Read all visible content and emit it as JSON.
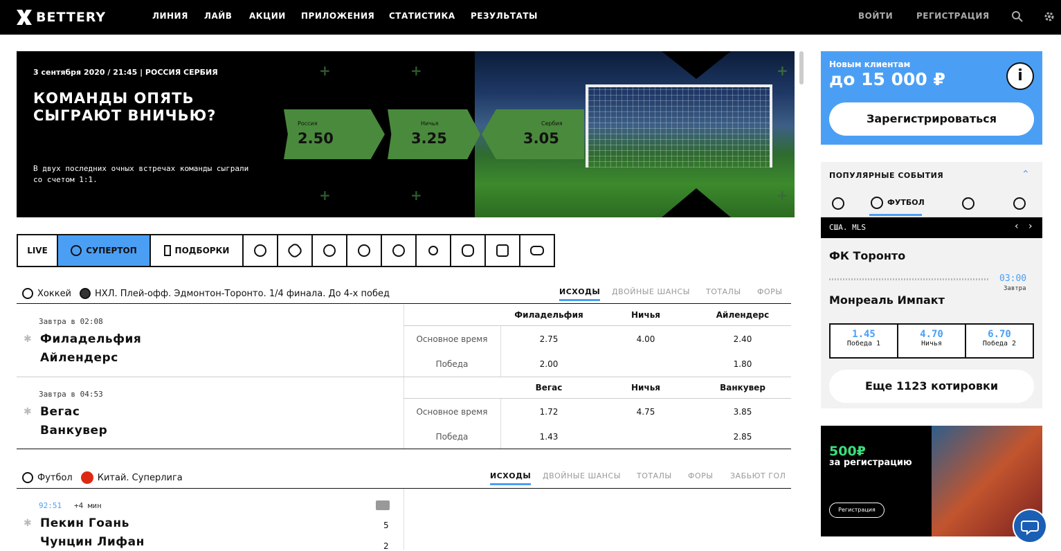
{
  "header": {
    "logo": "BETTERY",
    "nav": [
      "ЛИНИЯ",
      "ЛАЙВ",
      "АКЦИИ",
      "ПРИЛОЖЕНИЯ",
      "СТАТИСТИКА",
      "РЕЗУЛЬТАТЫ"
    ],
    "login": "ВОЙТИ",
    "register": "РЕГИСТРАЦИЯ"
  },
  "banner": {
    "date": "3 сентября 2020 / 21:45 | РОССИЯ СЕРБИЯ",
    "headline": "КОМАНДЫ ОПЯТЬ СЫГРАЮТ ВНИЧЬЮ?",
    "description": "В двух последних очных встречах команды сыграли со счетом 1:1.",
    "odds": [
      {
        "name": "Россия",
        "value": "2.50"
      },
      {
        "name": "Ничья",
        "value": "3.25"
      },
      {
        "name": "Сербия",
        "value": "3.05"
      }
    ]
  },
  "sport_tabs": {
    "live": "LIVE",
    "supertop": "СУПЕРТОП",
    "collections": "ПОДБОРКИ"
  },
  "hockey": {
    "sport": "Хоккей",
    "league": "НХЛ. Плей-офф. Эдмонтон-Торонто. 1/4 финала. До 4-х побед",
    "tabs": [
      "ИСХОДЫ",
      "ДВОЙНЫЕ ШАНСЫ",
      "ТОТАЛЫ",
      "ФОРЫ"
    ],
    "matches": [
      {
        "when": "Завтра в 02:08",
        "team1": "Филадельфия",
        "team2": "Айлендерс",
        "cols": [
          "Филадельфия",
          "Ничья",
          "Айлендерс"
        ],
        "row1_label": "Основное время",
        "row1": [
          "2.75",
          "4.00",
          "2.40"
        ],
        "row2_label": "Победа",
        "row2": [
          "2.00",
          "",
          "1.80"
        ]
      },
      {
        "when": "Завтра в 04:53",
        "team1": "Вегас",
        "team2": "Ванкувер",
        "cols": [
          "Вегас",
          "Ничья",
          "Ванкувер"
        ],
        "row1_label": "Основное время",
        "row1": [
          "1.72",
          "4.75",
          "3.85"
        ],
        "row2_label": "Победа",
        "row2": [
          "1.43",
          "",
          "2.85"
        ]
      }
    ]
  },
  "football": {
    "sport": "Футбол",
    "league": "Китай. Суперлига",
    "tabs": [
      "ИСХОДЫ",
      "ДВОЙНЫЕ ШАНСЫ",
      "ТОТАЛЫ",
      "ФОРЫ",
      "ЗАБЬЮТ ГОЛ"
    ],
    "match": {
      "minute": "92:51",
      "added": "+4 мин",
      "team1": "Пекин Гоань",
      "score1": "5",
      "team2": "Чунцин Лифан",
      "score2": "2"
    }
  },
  "promo": {
    "line1": "Новым клиентам",
    "line2": "до 15 000 ₽",
    "button": "Зарегистрироваться"
  },
  "popular": {
    "title": "ПОПУЛЯРНЫЕ СОБЫТИЯ",
    "active_tab": "ФУТБОЛ",
    "league": "США. MLS",
    "team1": "ФК Торонто",
    "team2": "Монреаль Импакт",
    "time": "03:00",
    "day": "Завтра",
    "odds": [
      {
        "value": "1.45",
        "label": "Победа 1"
      },
      {
        "value": "4.70",
        "label": "Ничья"
      },
      {
        "value": "6.70",
        "label": "Победа 2"
      }
    ],
    "more": "Еще 1123 котировки"
  },
  "ad": {
    "amount": "500₽",
    "text": "за регистрацию",
    "button": "Регистрация"
  },
  "colors": {
    "accent": "#4a9ff5",
    "odds_green": "#4a8a3c",
    "header_bg": "#000000"
  }
}
